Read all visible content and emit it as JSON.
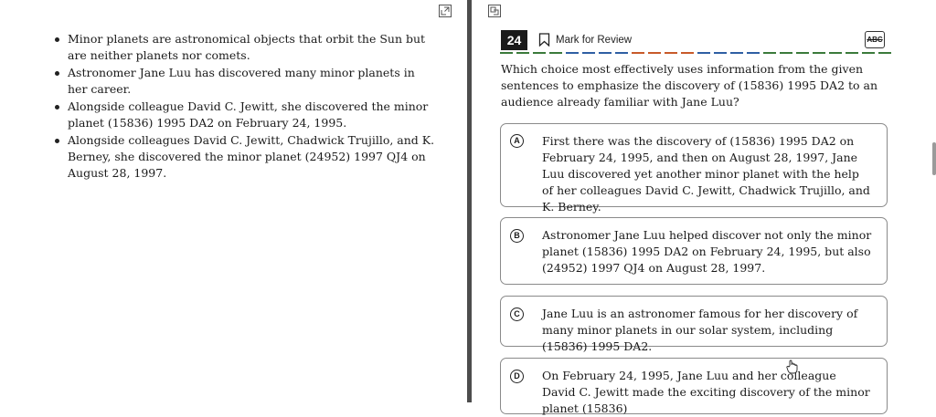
{
  "passage": {
    "bullets": [
      "Minor planets are astronomical objects that orbit the Sun but are neither planets nor comets.",
      "Astronomer Jane Luu has discovered many minor planets in her career.",
      "Alongside colleague David C. Jewitt, she discovered the minor planet (15836) 1995 DA2 on February 24, 1995.",
      "Alongside colleagues David C. Jewitt, Chadwick Trujillo, and K. Berney, she discovered the minor planet (24952) 1997 QJ4 on August 28, 1997."
    ]
  },
  "question": {
    "number": "24",
    "mark_for_review_label": "Mark for Review",
    "abc_label": "ABC",
    "stem": "Which choice most effectively uses information from the given sentences to emphasize the discovery of (15836) 1995 DA2 to an audience already familiar with Jane Luu?",
    "choices": [
      {
        "letter": "A",
        "text": "First there was the discovery of (15836) 1995 DA2 on February 24, 1995, and then on August 28, 1997, Jane Luu discovered yet another minor planet with the help of her colleagues David C. Jewitt, Chadwick Trujillo, and K. Berney."
      },
      {
        "letter": "B",
        "text": "Astronomer Jane Luu helped discover not only the minor planet (15836) 1995 DA2 on February 24, 1995, but also (24952) 1997 QJ4 on August 28, 1997."
      },
      {
        "letter": "C",
        "text": "Jane Luu is an astronomer famous for her discovery of many minor planets in our solar system, including (15836) 1995 DA2."
      },
      {
        "letter": "D",
        "text": "On February 24, 1995, Jane Luu and her colleague David C. Jewitt made the exciting discovery of the minor planet (15836)"
      }
    ]
  },
  "icons": {
    "left_expand": "expand-icon",
    "right_collapse": "collapse-icon",
    "bookmark": "bookmark-icon",
    "cursor": "hand-cursor-icon"
  },
  "colors": {
    "dash_colors": [
      "#3b7a3b",
      "#2f5fa3",
      "#c85a2a",
      "#2f5fa3",
      "#3b7a3b"
    ]
  }
}
